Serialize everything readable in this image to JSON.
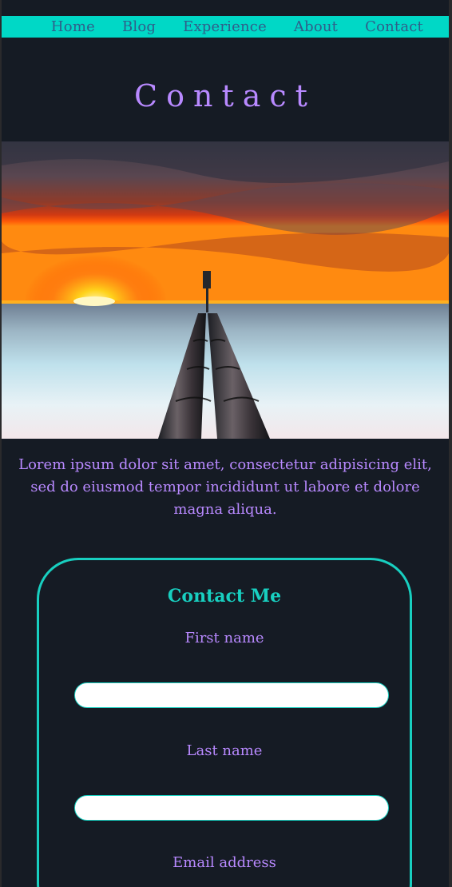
{
  "nav": {
    "items": [
      {
        "label": "Home"
      },
      {
        "label": "Blog"
      },
      {
        "label": "Experience"
      },
      {
        "label": "About"
      },
      {
        "label": "Contact"
      }
    ]
  },
  "page": {
    "title": "Contact",
    "intro": "Lorem ipsum dolor sit amet, consectetur adipisicing elit, sed do eiusmod tempor incididunt ut labore et dolore magna aliqua."
  },
  "hero": {
    "image": "sunset over the sea with pipes extending into the water"
  },
  "form": {
    "heading": "Contact Me",
    "fields": [
      {
        "label": "First name",
        "value": "",
        "placeholder": ""
      },
      {
        "label": "Last name",
        "value": "",
        "placeholder": ""
      },
      {
        "label": "Email address",
        "value": "",
        "placeholder": ""
      }
    ]
  },
  "colors": {
    "nav_bg": "#00d8c6",
    "nav_text": "#2f5f8a",
    "page_bg": "#151b24",
    "accent_purple": "#b889ff",
    "accent_teal": "#18cfc0"
  }
}
